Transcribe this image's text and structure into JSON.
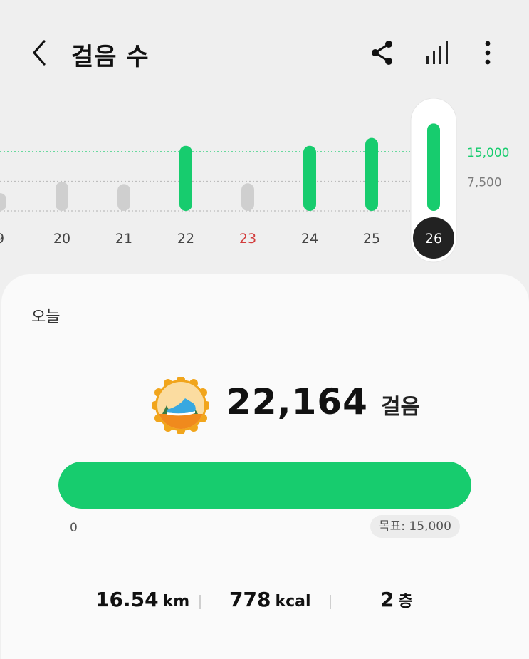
{
  "header": {
    "title": "걸음 수"
  },
  "icons": {
    "back": "chevron-left-icon",
    "share": "share-icon",
    "stats": "bar-chart-icon",
    "more": "more-vertical-icon"
  },
  "colors": {
    "accent": "#17cc6e",
    "inactive_bar": "#cfcfcf",
    "weekend": "#d23c3c",
    "selected_bg": "#222222"
  },
  "chart_data": {
    "type": "bar",
    "categories": [
      "9",
      "20",
      "21",
      "22",
      "23",
      "24",
      "25",
      "26"
    ],
    "values": [
      4500,
      7400,
      6800,
      16500,
      7000,
      16500,
      18500,
      22164
    ],
    "goal_reached": [
      false,
      false,
      false,
      true,
      false,
      true,
      true,
      true
    ],
    "weekend": [
      "23"
    ],
    "selected": "26",
    "y_labels": [
      "15,000",
      "7,500"
    ],
    "y_values": [
      15000,
      7500
    ],
    "goal": 15000
  },
  "today": {
    "label": "오늘",
    "steps": "22,164",
    "steps_unit": "걸음",
    "progress_ratio": 1.0,
    "progress_min": "0",
    "goal_label": "목표: 15,000"
  },
  "stats": {
    "distance": "16.54",
    "distance_unit": "km",
    "calories": "778",
    "calories_unit": "kcal",
    "floors": "2",
    "floors_unit": "층"
  }
}
